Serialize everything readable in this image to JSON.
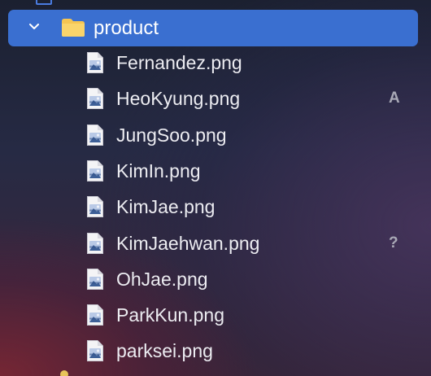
{
  "sidebar": {
    "folder": {
      "name": "product",
      "expanded": true,
      "icon": "folder-icon",
      "chevron_icon": "chevron-down-icon",
      "folder_color": "#F6C552",
      "selection_color": "#3A6FD0"
    },
    "files": [
      {
        "name": "Fernandez.png",
        "badge": ""
      },
      {
        "name": "HeoKyung.png",
        "badge": "A"
      },
      {
        "name": "JungSoo.png",
        "badge": ""
      },
      {
        "name": "KimIn.png",
        "badge": ""
      },
      {
        "name": "KimJae.png",
        "badge": ""
      },
      {
        "name": "KimJaehwan.png",
        "badge": "?"
      },
      {
        "name": "OhJae.png",
        "badge": ""
      },
      {
        "name": "ParkKun.png",
        "badge": ""
      },
      {
        "name": "parksei.png",
        "badge": ""
      }
    ],
    "file_icon": "image-file-icon"
  }
}
